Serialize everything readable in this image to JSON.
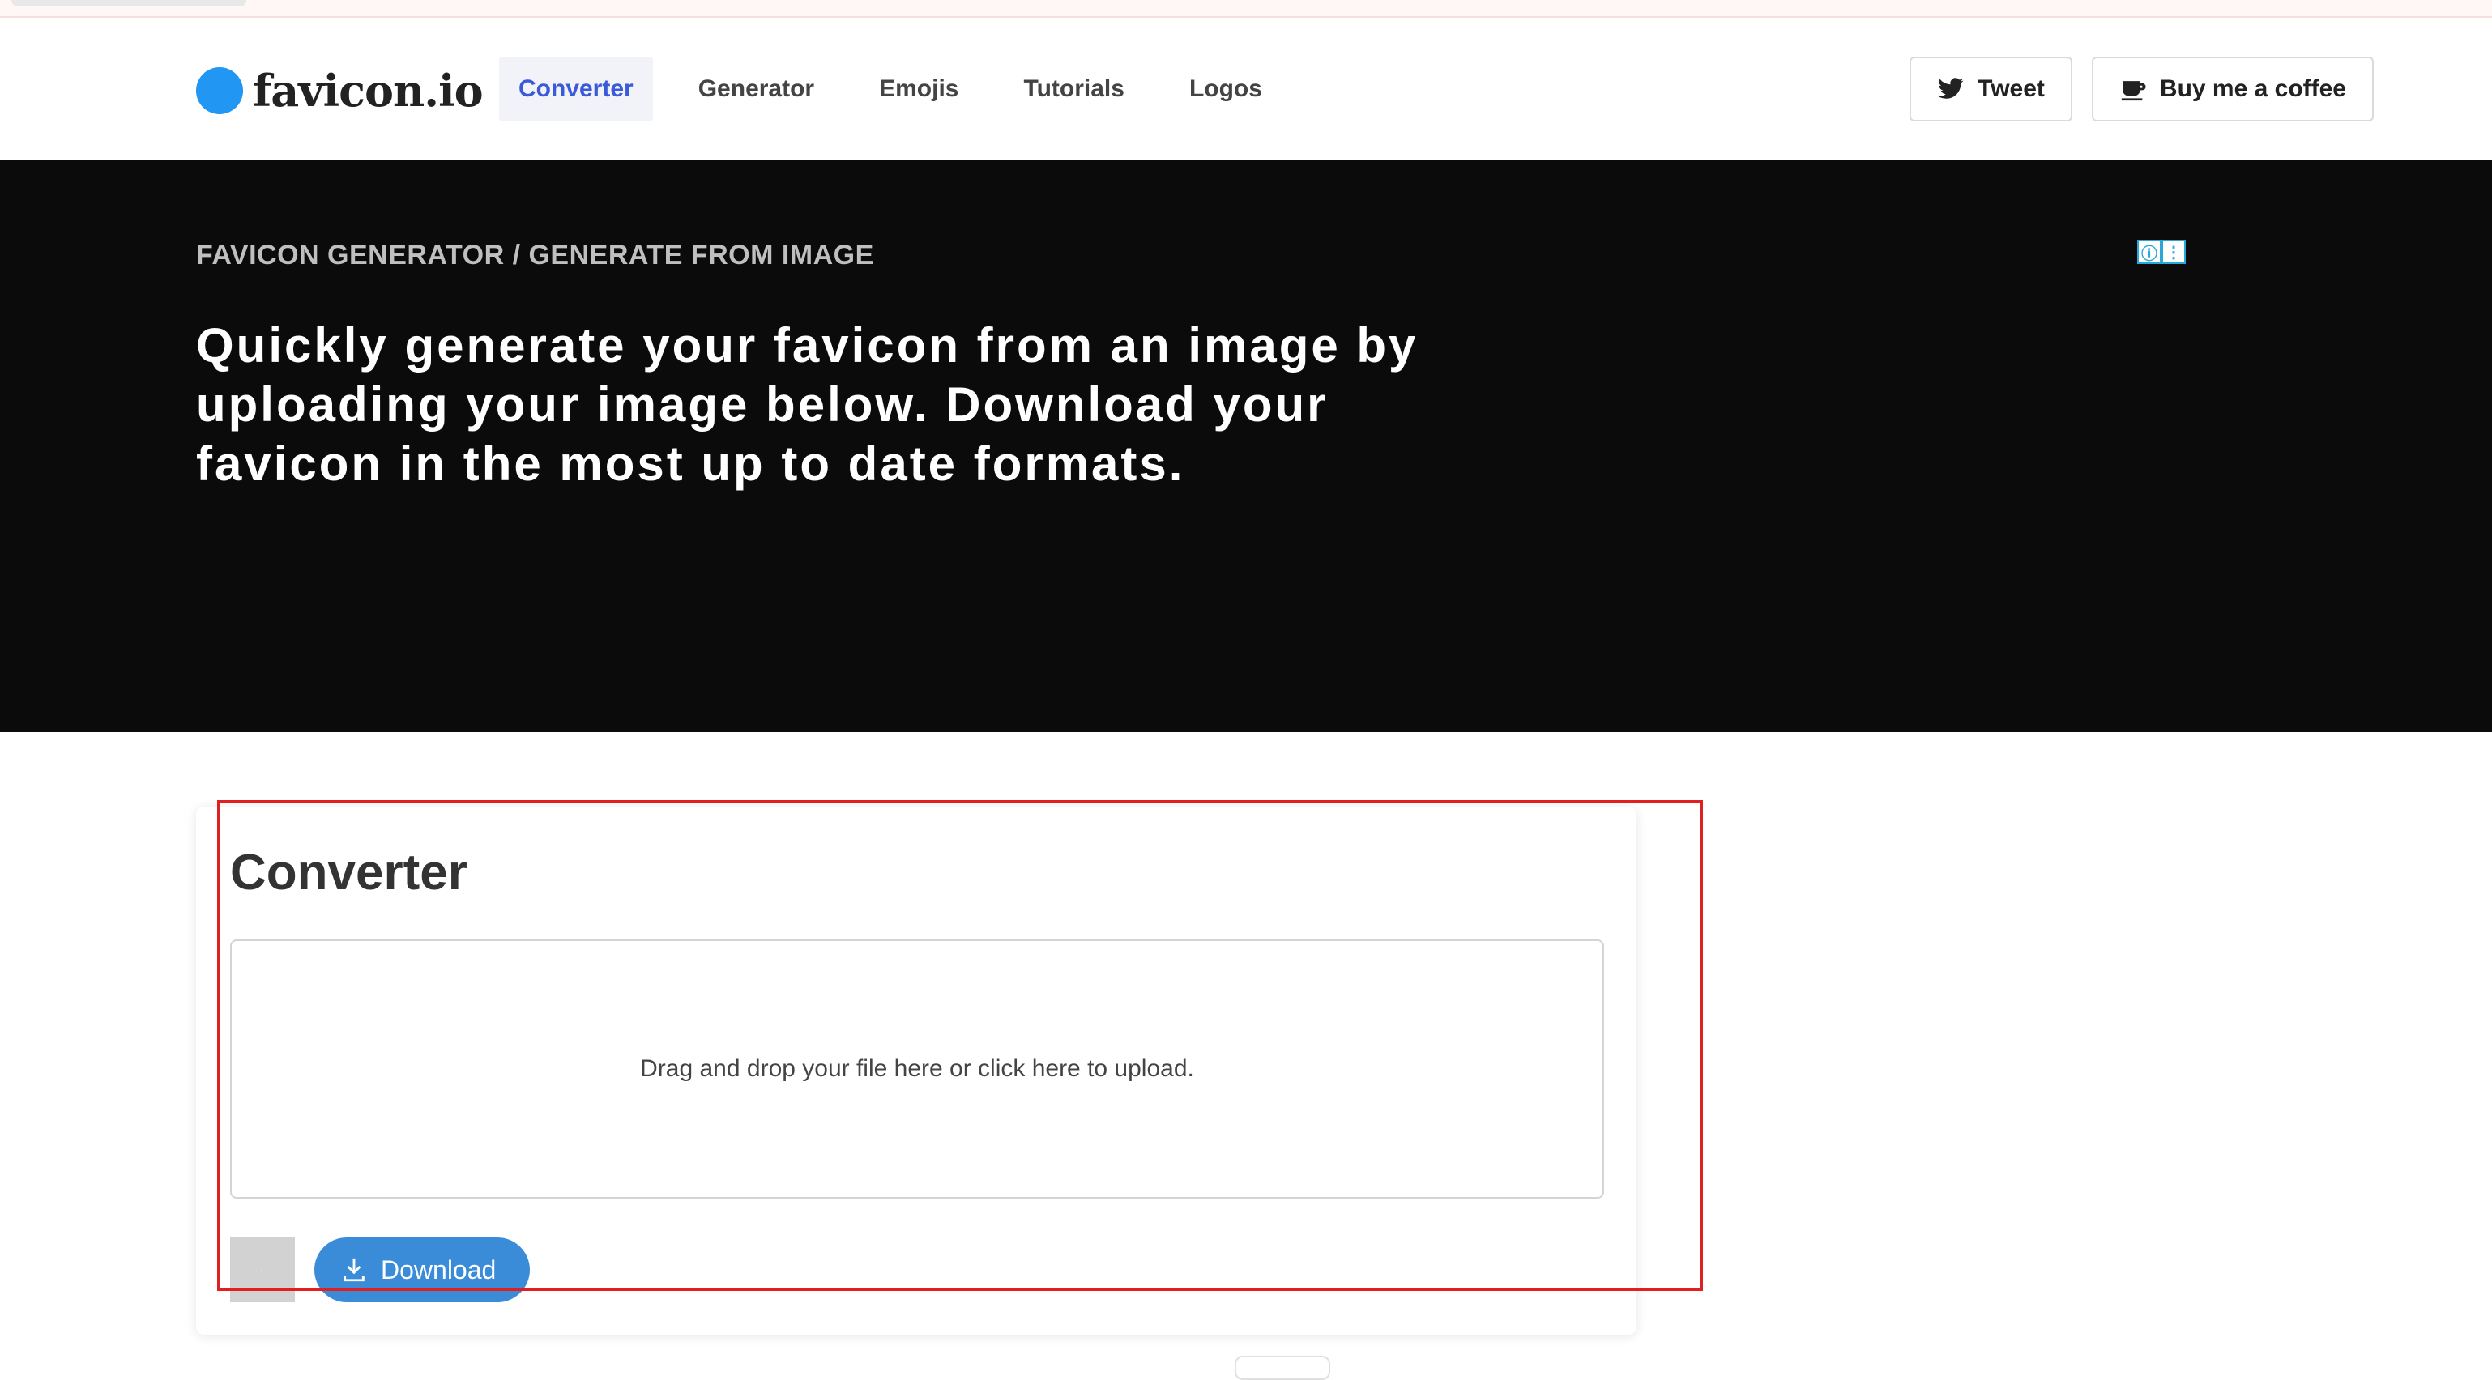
{
  "brand": {
    "name": "favicon.io",
    "dot_color": "#2196f3"
  },
  "nav": {
    "links": [
      {
        "label": "Converter",
        "active": true
      },
      {
        "label": "Generator",
        "active": false
      },
      {
        "label": "Emojis",
        "active": false
      },
      {
        "label": "Tutorials",
        "active": false
      },
      {
        "label": "Logos",
        "active": false
      }
    ],
    "tweet_label": "Tweet",
    "coffee_label": "Buy me a coffee"
  },
  "hero": {
    "breadcrumb": "FAVICON GENERATOR / GENERATE FROM IMAGE",
    "headline_lines": [
      "Quickly generate your favicon from an image by",
      "uploading your image below. Download your",
      "favicon in the most up to date formats."
    ],
    "ad_info_icon": "ⓘ",
    "ad_menu_icon": "⋮"
  },
  "converter": {
    "title": "Converter",
    "dropzone_text": "Drag and drop your file here or click here to upload.",
    "download_label": "Download"
  },
  "colors": {
    "hero_bg": "#0b0b0b",
    "accent": "#3a5ad8",
    "download_bg": "#3b8cd8",
    "highlight_border": "#e02020"
  }
}
